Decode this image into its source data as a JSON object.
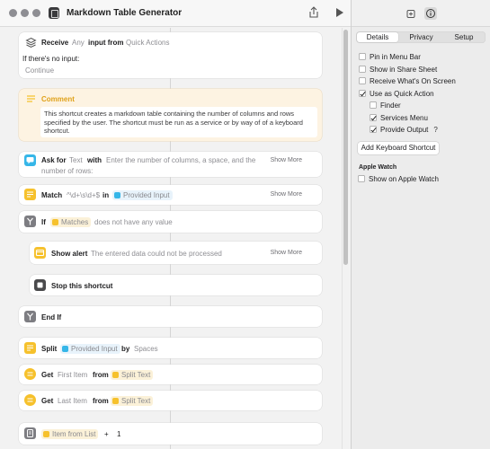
{
  "window": {
    "title": "Markdown Table Generator"
  },
  "receive": {
    "action": "Receive",
    "type": "Any",
    "input_from": "input from",
    "source": "Quick Actions",
    "no_input_label": "If there's no input:",
    "no_input_value": "Continue"
  },
  "comment": {
    "title": "Comment",
    "text": "This shortcut creates a markdown table containing the number of columns and rows specified by the user. The shortcut must be run as a service or by way of of a keyboard shortcut."
  },
  "ask": {
    "action": "Ask for",
    "type": "Text",
    "with": "with",
    "prompt": "Enter the number of columns, a space, and the",
    "prompt2": "number of rows:",
    "show_more": "Show More"
  },
  "match": {
    "action": "Match",
    "pattern": "^\\d+\\s\\d+$",
    "in": "in",
    "variable": "Provided Input",
    "show_more": "Show More"
  },
  "if_block": {
    "action": "If",
    "variable": "Matches",
    "condition": "does not have any value"
  },
  "alert": {
    "action": "Show alert",
    "message": "The entered data could not be processed",
    "show_more": "Show More"
  },
  "stop": {
    "action": "Stop this shortcut"
  },
  "end_if": {
    "action": "End If"
  },
  "split": {
    "action": "Split",
    "variable": "Provided Input",
    "by": "by",
    "separator": "Spaces"
  },
  "get_first": {
    "action": "Get",
    "item": "First Item",
    "from": "from",
    "variable": "Split Text"
  },
  "get_last": {
    "action": "Get",
    "item": "Last Item",
    "from": "from",
    "variable": "Split Text"
  },
  "item_from_list": {
    "variable": "Item from List",
    "operator": "+",
    "operand": "1"
  },
  "inspector": {
    "tabs": [
      "Details",
      "Privacy",
      "Setup"
    ],
    "active_tab": "Details",
    "options": [
      {
        "label": "Pin in Menu Bar",
        "checked": false
      },
      {
        "label": "Show in Share Sheet",
        "checked": false
      },
      {
        "label": "Receive What's On Screen",
        "checked": false
      },
      {
        "label": "Use as Quick Action",
        "checked": true
      },
      {
        "label": "Finder",
        "checked": false
      },
      {
        "label": "Services Menu",
        "checked": true
      },
      {
        "label": "Provide Output",
        "checked": true
      }
    ],
    "help": "?",
    "keyboard_button": "Add Keyboard Shortcut",
    "watch_section": "Apple Watch",
    "watch_option": {
      "label": "Show on Apple Watch",
      "checked": false
    }
  },
  "colors": {
    "yellow": "#f6c12c",
    "teal": "#35b6e8",
    "gray": "#7d7d82",
    "comment_bg": "#fdf3e2"
  },
  "icons": [
    "receive-icon",
    "comment-icon",
    "ask-icon",
    "match-icon",
    "if-icon",
    "alert-icon",
    "stop-icon",
    "split-icon",
    "get-icon",
    "calculate-icon"
  ]
}
